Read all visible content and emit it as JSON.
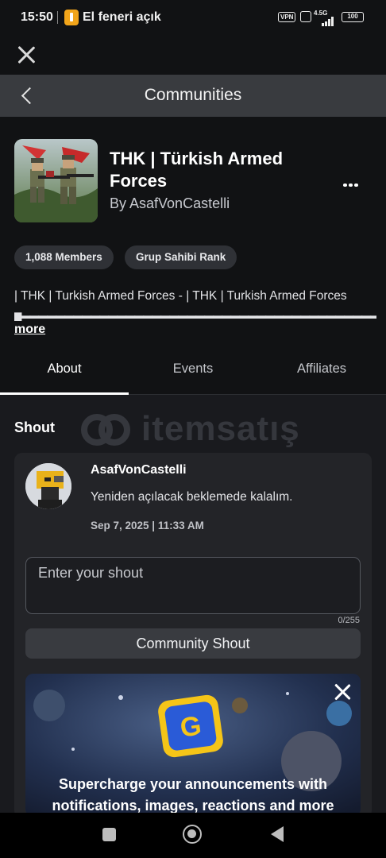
{
  "status_bar": {
    "time": "15:50",
    "torch_label": "El feneri açık",
    "vpn": "VPN",
    "network": "4.5G",
    "battery": "100"
  },
  "header": {
    "title": "Communities"
  },
  "community": {
    "name": "THK | Türkish Armed Forces",
    "by": "By AsafVonCastelli",
    "members_chip": "1,088 Members",
    "rank_chip": "Grup Sahibi Rank",
    "description": "| THK | Turkish Armed Forces - | THK | Turkish Armed Forces",
    "description_line2": "▆▬▬▬▬▬▬▬▬▬▬▬▬▬▬▬▬▬▬▬▬▬▬▬▬▬▬▬▬▬▬▬▬▬▬▬▬▬▬▬▬▬▆...",
    "more_label": "more"
  },
  "tabs": [
    {
      "label": "About",
      "active": true
    },
    {
      "label": "Events",
      "active": false
    },
    {
      "label": "Affiliates",
      "active": false
    }
  ],
  "shout_section": {
    "title": "Shout",
    "user": "AsafVonCastelli",
    "message": "Yeniden açılacak beklemede kalalım.",
    "date": "Sep 7, 2025 | 11:33 AM",
    "input_placeholder": "Enter your shout",
    "counter": "0/255",
    "button_label": "Community Shout"
  },
  "watermark": {
    "text": "itemsatış"
  },
  "promo": {
    "text": "Supercharge your announcements with notifications, images, reactions and more"
  },
  "colors": {
    "background": "#111214",
    "header_bg": "#393b3f",
    "card_bg": "#232428",
    "chip_bg": "#2f3136",
    "promo_logo": "#f5c518"
  }
}
